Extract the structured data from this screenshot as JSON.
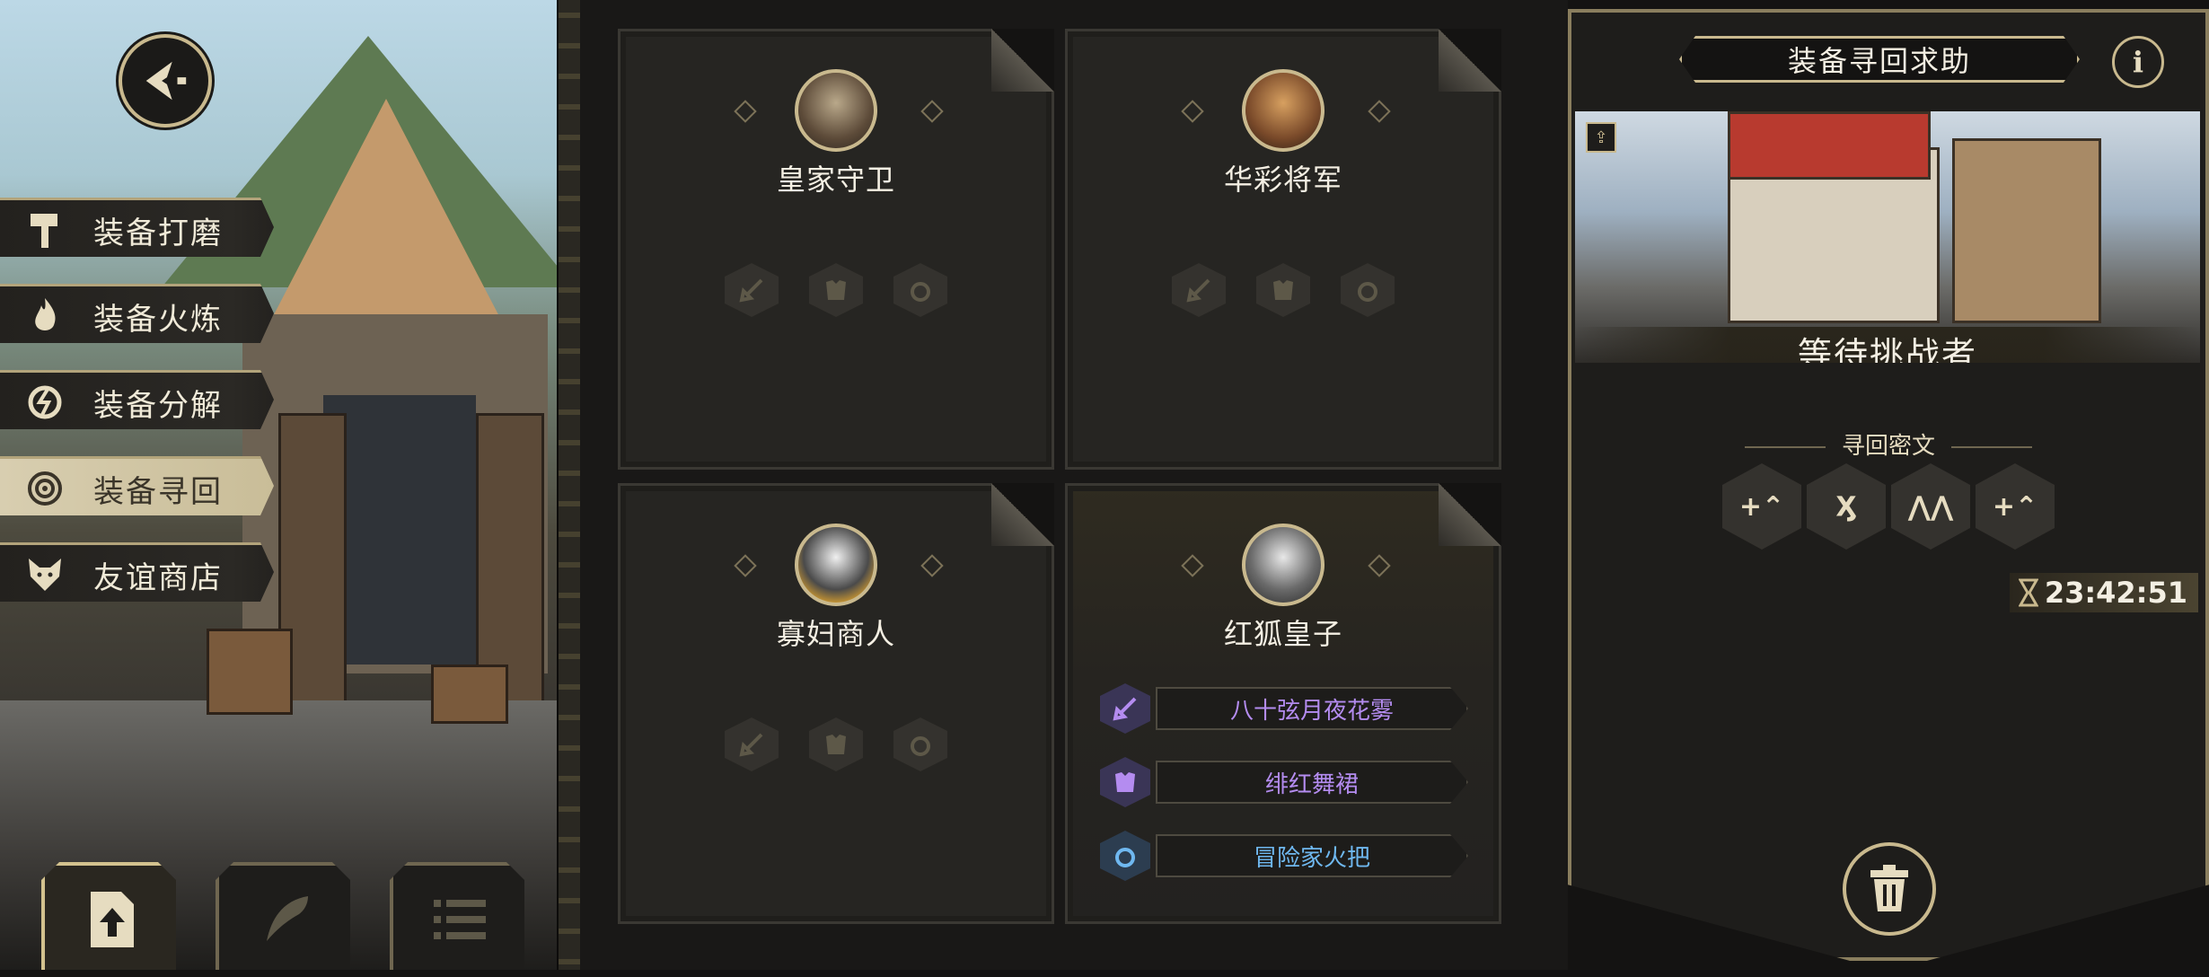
{
  "side_menu": [
    {
      "label": "装备打磨",
      "icon": "hammer-icon"
    },
    {
      "label": "装备火炼",
      "icon": "flame-icon"
    },
    {
      "label": "装备分解",
      "icon": "broken-gear-icon"
    },
    {
      "label": "装备寻回",
      "icon": "target-icon",
      "active": true
    },
    {
      "label": "友谊商店",
      "icon": "fox-icon"
    }
  ],
  "bottom_tabs": [
    "upload-file-icon",
    "feather-icon",
    "list-icon"
  ],
  "cards": [
    {
      "name": "皇家守卫",
      "loot": []
    },
    {
      "name": "华彩将军",
      "loot": []
    },
    {
      "name": "寡妇商人",
      "loot": []
    },
    {
      "name": "红狐皇子",
      "loot": [
        {
          "label": "八十弦月夜花雾",
          "color": "#b48cf0",
          "icon": "sword-icon"
        },
        {
          "label": "绯红舞裙",
          "color": "#b48cf0",
          "icon": "armor-icon"
        },
        {
          "label": "冒险家火把",
          "color": "#6fb8f0",
          "icon": "ring-icon"
        }
      ]
    }
  ],
  "panel": {
    "title": "装备寻回求助",
    "info": "i",
    "status": "等待挑战者",
    "cipher_label": "寻回密文",
    "ciphers": [
      "+⌃",
      "Ӽ",
      "⋀⋀",
      "+⌃"
    ],
    "timer": "23:42:51"
  },
  "colors": {
    "gold": "#c9b98e",
    "purple": "#b48cf0",
    "blue": "#6fb8f0"
  }
}
